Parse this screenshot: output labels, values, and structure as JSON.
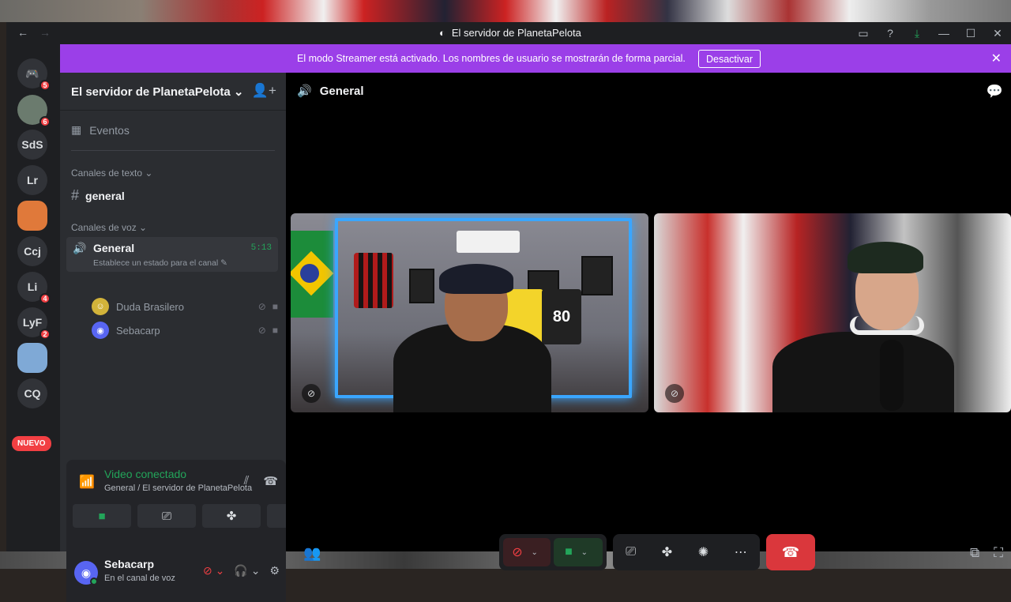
{
  "titlebar": {
    "back": "←",
    "forward": "→",
    "title": "El servidor de PlanetaPelota",
    "icons": [
      "inbox-icon",
      "help-icon",
      "download-icon",
      "minimize-icon",
      "maximize-icon",
      "close-icon"
    ]
  },
  "streamer": {
    "message": "El modo Streamer está activado. Los nombres de usuario se mostrarán de forma parcial.",
    "button": "Desactivar",
    "close": "✕"
  },
  "rail": {
    "servers": [
      {
        "label": "",
        "badge": "5"
      },
      {
        "label": "",
        "badge": "6"
      },
      {
        "label": "SdS",
        "badge": ""
      },
      {
        "label": "Lr",
        "badge": ""
      },
      {
        "label": "",
        "badge": ""
      },
      {
        "label": "Ccj",
        "badge": ""
      },
      {
        "label": "Li",
        "badge": "4"
      },
      {
        "label": "LyF",
        "badge": "2"
      },
      {
        "label": "",
        "badge": ""
      },
      {
        "label": "CQ",
        "badge": ""
      }
    ],
    "nuevo": "NUEVO"
  },
  "sidebar": {
    "server_name": "El servidor de PlanetaPelota",
    "events": "Eventos",
    "text_category": "Canales de texto",
    "text_channel": "general",
    "voice_category": "Canales de voz",
    "voice_channel": {
      "name": "General",
      "time": "5:13",
      "status": "Establece un estado para el canal"
    },
    "members": [
      "Duda Brasilero",
      "Sebacarp"
    ]
  },
  "voice_panel": {
    "title": "Video conectado",
    "subtitle": "General / El servidor de PlanetaPelota"
  },
  "user_panel": {
    "name": "Sebacarp",
    "status": "En el canal de voz"
  },
  "stage": {
    "channel": "General",
    "jersey_number": "80"
  },
  "colors": {
    "streamer_bar": "#9b3fe8",
    "connected_green": "#23a55a",
    "hangup_red": "#da373c"
  }
}
